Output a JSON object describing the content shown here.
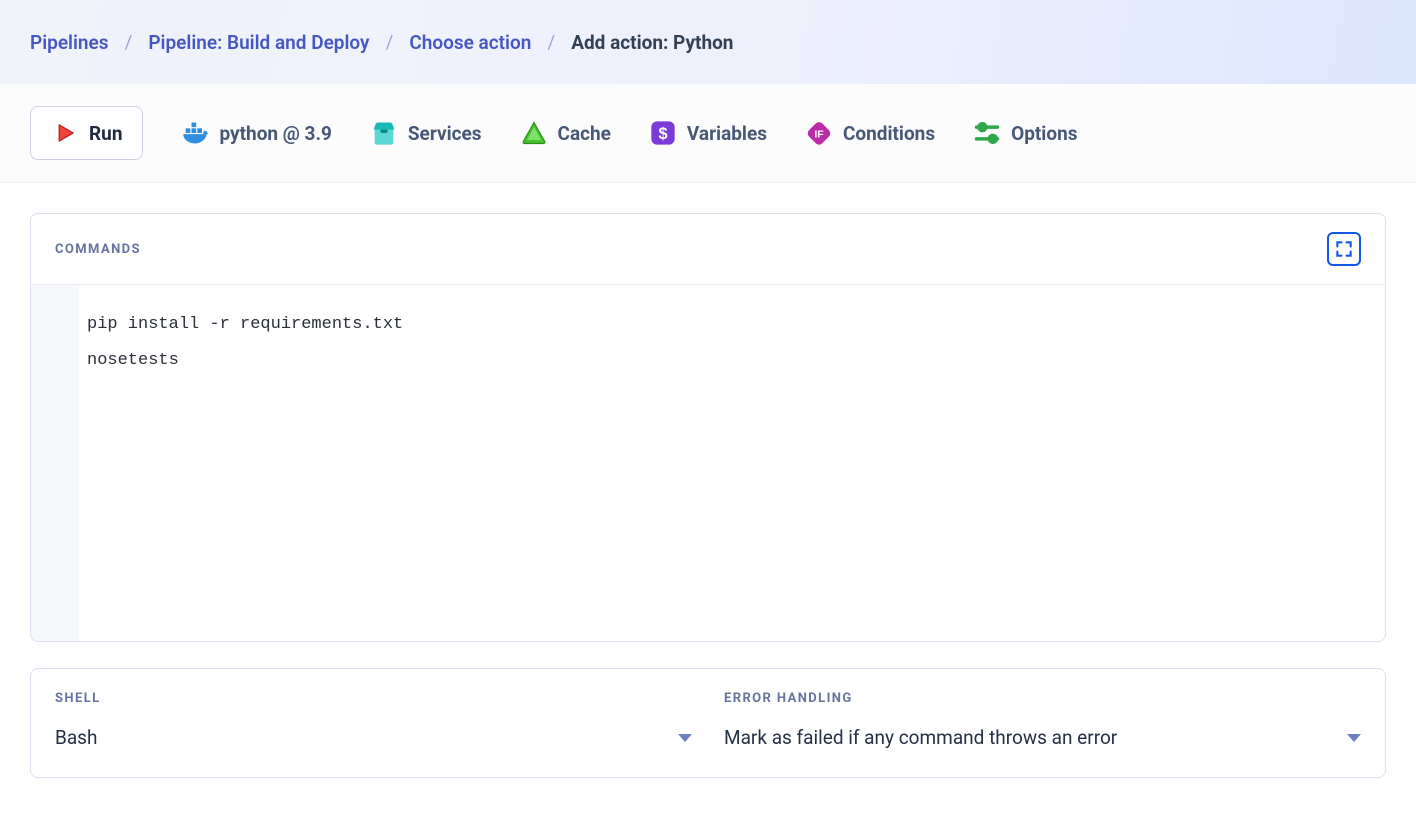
{
  "breadcrumb": {
    "items": [
      {
        "label": "Pipelines"
      },
      {
        "label": "Pipeline: Build and Deploy"
      },
      {
        "label": "Choose action"
      }
    ],
    "current": "Add action: Python"
  },
  "tabs": {
    "run": "Run",
    "environment": "python @ 3.9",
    "services": "Services",
    "cache": "Cache",
    "variables": "Variables",
    "conditions": "Conditions",
    "options": "Options"
  },
  "commands": {
    "title": "COMMANDS",
    "code": "pip install -r requirements.txt\nnosetests"
  },
  "shell": {
    "title": "SHELL",
    "value": "Bash"
  },
  "error_handling": {
    "title": "ERROR HANDLING",
    "value": "Mark as failed if any command throws an error"
  }
}
